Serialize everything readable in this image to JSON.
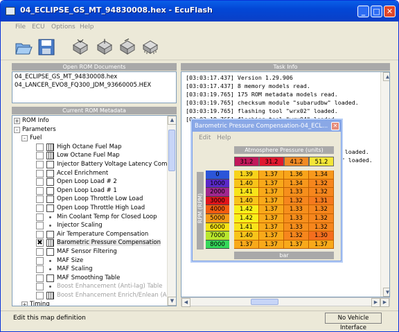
{
  "window": {
    "title": "04_ECLIPSE_GS_MT_94830008.hex - EcuFlash"
  },
  "menu": [
    "File",
    "ECU",
    "Options",
    "Help"
  ],
  "toolbar": {
    "icons": [
      "open-folder-icon",
      "save-icon",
      "chip-read-icon",
      "chip-write-icon",
      "chip-test-icon",
      "chip-icon"
    ]
  },
  "open_rom_documents": {
    "title": "Open ROM Documents",
    "items": [
      "04_ECLIPSE_GS_MT_94830008.hex",
      "04_LANCER_EVO8_FQ300_JDM_93660005.HEX"
    ]
  },
  "rom_metadata": {
    "title": "Current ROM Metadata",
    "tree": [
      {
        "label": "ROM Info",
        "level": 0,
        "expander": "+"
      },
      {
        "label": "Parameters",
        "level": 0,
        "expander": "-"
      },
      {
        "label": "Fuel",
        "level": 1,
        "expander": "-"
      },
      {
        "label": "High Octane Fuel Map",
        "level": 2,
        "icon": "grid",
        "checked": false
      },
      {
        "label": "Low Octane Fuel Map",
        "level": 2,
        "icon": "grid",
        "checked": false
      },
      {
        "label": "Injector Battery Voltage Latency Com...",
        "level": 2,
        "icon": "bar",
        "checked": false
      },
      {
        "label": "Accel Enrichment",
        "level": 2,
        "icon": "bar",
        "checked": false
      },
      {
        "label": "Open Loop Load # 2",
        "level": 2,
        "icon": "bar",
        "checked": false
      },
      {
        "label": "Open Loop Load # 1",
        "level": 2,
        "icon": "bar",
        "checked": false
      },
      {
        "label": "Open Loop Throttle Low Load",
        "level": 2,
        "icon": "bar",
        "checked": false
      },
      {
        "label": "Open Loop Throttle High Load",
        "level": 2,
        "icon": "bar",
        "checked": false
      },
      {
        "label": "Min Coolant Temp for Closed Loop",
        "level": 2,
        "icon": "dot",
        "checked": false
      },
      {
        "label": "Injector Scaling",
        "level": 2,
        "icon": "dot",
        "checked": false
      },
      {
        "label": "Air Temperature Compensation",
        "level": 2,
        "icon": "bar",
        "checked": false
      },
      {
        "label": "Barometric Pressure Compensation",
        "level": 2,
        "icon": "grid",
        "checked": true,
        "selected": true
      },
      {
        "label": "MAF Sensor Filtering",
        "level": 2,
        "icon": "bar",
        "checked": false
      },
      {
        "label": "MAF Size",
        "level": 2,
        "icon": "dot",
        "checked": false
      },
      {
        "label": "MAF Scaling",
        "level": 2,
        "icon": "dot",
        "checked": false
      },
      {
        "label": "MAF Smoothing Table",
        "level": 2,
        "icon": "bar",
        "checked": false
      },
      {
        "label": "Boost Enhancement (Anti-lag) Table",
        "level": 2,
        "icon": "dot",
        "checked": false,
        "disabled": true
      },
      {
        "label": "Boost Enhancement Enrich/Enlean (An...",
        "level": 2,
        "icon": "grid",
        "checked": false,
        "disabled": true
      },
      {
        "label": "Timing",
        "level": 1,
        "expander": "+"
      }
    ]
  },
  "task_info": {
    "title": "Task Info",
    "log": [
      "[03:03:17.437] Version 1.29.906",
      "[03:03:17.437] 8 memory models read.",
      "[03:03:19.765] 175 ROM metadata models read.",
      "[03:03:19.765] checksum module \"subarudbw\" loaded.",
      "[03:03:19.765] flashing tool \"wrx02\" loaded.",
      "[03:03:19.765] flashing tool \"wrx04\" loaded.",
      "",
      "",
      "",
      "                                          cp\" loaded.",
      "                                          der\" loaded."
    ]
  },
  "status": {
    "text": "Edit this map definition",
    "interface": "No Vehicle Interface"
  },
  "table_window": {
    "title": "Barometric Pressure Compensation-04_ECL...",
    "menu": [
      "Edit",
      "Help"
    ],
    "x_axis_title": "Atmosphere Pressure (units)",
    "y_axis_title": "RPM (RPM)",
    "x_values": [
      "31.2",
      "31.2",
      "41.2",
      "51.2"
    ],
    "x_colors": [
      "#c2185b",
      "#e0192e",
      "#f08a24",
      "#f3e638"
    ],
    "y_values": [
      "0",
      "1000",
      "2000",
      "3000",
      "4000",
      "5000",
      "6000",
      "7000",
      "8000"
    ],
    "y_colors": [
      "#2b55d9",
      "#5a28c8",
      "#a0278f",
      "#e0141b",
      "#f25c10",
      "#f59a16",
      "#f4e014",
      "#b8e62c",
      "#34d85a"
    ],
    "cells": [
      [
        "1.39",
        "1.37",
        "1.36",
        "1.34"
      ],
      [
        "1.40",
        "1.37",
        "1.34",
        "1.32"
      ],
      [
        "1.41",
        "1.37",
        "1.33",
        "1.32"
      ],
      [
        "1.40",
        "1.37",
        "1.32",
        "1.31"
      ],
      [
        "1.42",
        "1.37",
        "1.33",
        "1.32"
      ],
      [
        "1.42",
        "1.37",
        "1.33",
        "1.32"
      ],
      [
        "1.41",
        "1.37",
        "1.33",
        "1.32"
      ],
      [
        "1.40",
        "1.37",
        "1.32",
        "1.30"
      ],
      [
        "1.37",
        "1.37",
        "1.37",
        "1.37"
      ]
    ],
    "cell_colors": [
      [
        "#f7d31a",
        "#f8a91a",
        "#f8a41a",
        "#f7981c"
      ],
      [
        "#f7c41a",
        "#f8a91a",
        "#f7981c",
        "#f6861d"
      ],
      [
        "#f8e41a",
        "#f8a91a",
        "#f68f1c",
        "#f6861d"
      ],
      [
        "#f7c41a",
        "#f8a91a",
        "#f6861d",
        "#f57a1e"
      ],
      [
        "#f8f01a",
        "#f8a91a",
        "#f68f1c",
        "#f6861d"
      ],
      [
        "#f8f01a",
        "#f8a91a",
        "#f68f1c",
        "#f6861d"
      ],
      [
        "#f8e41a",
        "#f8a91a",
        "#f68f1c",
        "#f6861d"
      ],
      [
        "#f7c41a",
        "#f8a91a",
        "#f6861d",
        "#f46e1e"
      ],
      [
        "#f8a91a",
        "#f8a91a",
        "#f8a91a",
        "#f8a91a"
      ]
    ],
    "footer": "bar"
  }
}
